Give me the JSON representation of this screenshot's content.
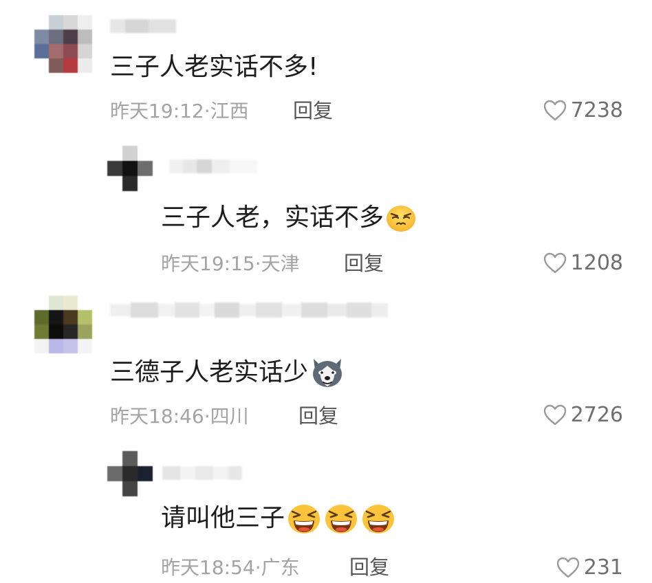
{
  "comments": [
    {
      "text": "三子人老实话不多!",
      "meta": "昨天19:12·江西",
      "reply_label": "回复",
      "likes": "7238",
      "avatar_colors": [
        "#ffffff",
        "#c9cfd6",
        "#d8d8d8",
        "#eeeeee",
        "#7e8ba3",
        "#6d6e80",
        "#4e3e4a",
        "#bdbdbd",
        "#5b6f9a",
        "#a56a6c",
        "#8c4a52",
        "#d5d5d5",
        "#ffffff",
        "#7f5b5b",
        "#b53a3e",
        "#ececec"
      ]
    },
    {
      "text": "三子人老，实话不多",
      "meta": "昨天19:15·天津",
      "reply_label": "回复",
      "likes": "1208",
      "emoji": "smirk-face-emoji"
    },
    {
      "text": "三德子人老实话少",
      "meta": "昨天18:46·四川",
      "reply_label": "回复",
      "likes": "2726",
      "emoji": "husky-dog-emoji",
      "avatar_colors": [
        "#ffffff",
        "#dfe6d2",
        "#e9e9d0",
        "#ffffff",
        "#5d6b2c",
        "#151515",
        "#4c3a20",
        "#b5c06a",
        "#6f7b34",
        "#0d0d0d",
        "#272727",
        "#9aa45d",
        "#f3f3f3",
        "#b9b7e8",
        "#c4c2ea",
        "#f4f4f4"
      ]
    },
    {
      "text": "请叫他三子",
      "meta": "昨天18:54·广东",
      "reply_label": "回复",
      "likes": "231",
      "emoji": "laughing-face-emoji"
    }
  ]
}
